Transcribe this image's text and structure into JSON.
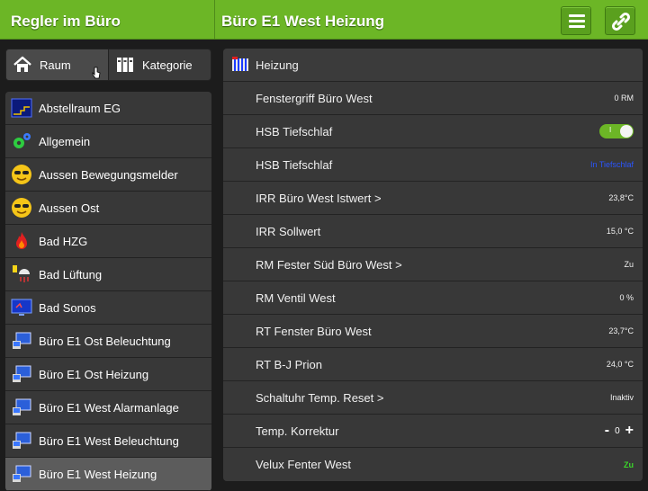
{
  "topbar": {
    "left_title": "Regler im Büro",
    "right_title": "Büro E1 West Heizung",
    "menu_icon": "hamburger-icon",
    "link_icon": "link-icon",
    "accent": "#6cb626"
  },
  "segment": {
    "room_label": "Raum",
    "category_label": "Kategorie"
  },
  "rooms": [
    {
      "label": "Abstellraum EG",
      "icon": "storage-room-icon"
    },
    {
      "label": "Allgemein",
      "icon": "gears-icon"
    },
    {
      "label": "Aussen Bewegungsmelder",
      "icon": "sunglasses-smiley-icon"
    },
    {
      "label": "Aussen Ost",
      "icon": "sunglasses-smiley-icon"
    },
    {
      "label": "Bad HZG",
      "icon": "flame-icon"
    },
    {
      "label": "Bad Lüftung",
      "icon": "shower-icon"
    },
    {
      "label": "Bad Sonos",
      "icon": "tv-monitor-icon"
    },
    {
      "label": "Büro E1 Ost Beleuchtung",
      "icon": "computer-icon"
    },
    {
      "label": "Büro E1 Ost Heizung",
      "icon": "computer-icon"
    },
    {
      "label": "Büro E1 West Alarmanlage",
      "icon": "computer-icon"
    },
    {
      "label": "Büro E1 West Beleuchtung",
      "icon": "computer-icon"
    },
    {
      "label": "Büro E1 West Heizung",
      "icon": "computer-icon"
    }
  ],
  "content": {
    "header_label": "Heizung",
    "header_icon": "radiator-icon",
    "rows": [
      {
        "label": "Fenstergriff Büro West",
        "value": "0 RM"
      },
      {
        "label": "HSB Tiefschlaf",
        "toggle_label": "I"
      },
      {
        "label": "HSB Tiefschlaf",
        "value": "In Tiefschlaf"
      },
      {
        "label": "IRR Büro West Istwert >",
        "value": "23,8°C"
      },
      {
        "label": "IRR Sollwert",
        "value": "15,0 °C"
      },
      {
        "label": "RM Fester Süd Büro West >",
        "value": "Zu"
      },
      {
        "label": "RM Ventil West",
        "value": "0 %"
      },
      {
        "label": "RT Fenster Büro West",
        "value": "23,7°C"
      },
      {
        "label": "RT B-J Prion",
        "value": "24,0 °C"
      },
      {
        "label": "Schaltuhr Temp. Reset >",
        "value": "Inaktiv"
      },
      {
        "label": "Temp. Korrektur",
        "minus": "-",
        "value": "0",
        "plus": "+"
      },
      {
        "label": "Velux Fenter West",
        "value": "Zu"
      }
    ]
  }
}
